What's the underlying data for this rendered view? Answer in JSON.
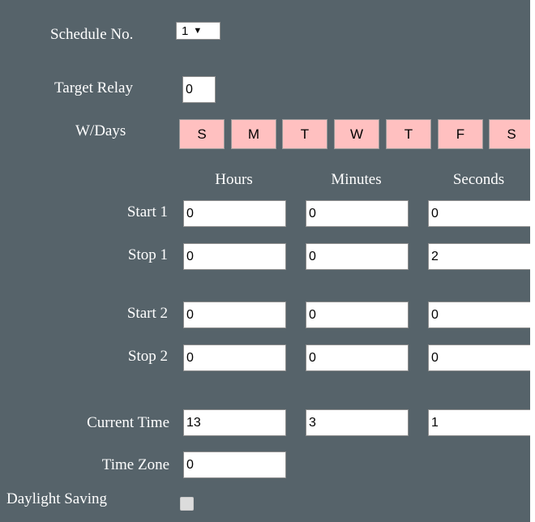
{
  "schedule": {
    "label": "Schedule No.",
    "selected": "1"
  },
  "target_relay": {
    "label": "Target Relay",
    "value": "0"
  },
  "weekdays": {
    "label": "W/Days",
    "days": [
      "S",
      "M",
      "T",
      "W",
      "T",
      "F",
      "S"
    ]
  },
  "columns": {
    "hours": "Hours",
    "minutes": "Minutes",
    "seconds": "Seconds"
  },
  "rows": {
    "start1": {
      "label": "Start 1",
      "hours": "0",
      "minutes": "0",
      "seconds": "0"
    },
    "stop1": {
      "label": "Stop 1",
      "hours": "0",
      "minutes": "0",
      "seconds": "2"
    },
    "start2": {
      "label": "Start 2",
      "hours": "0",
      "minutes": "0",
      "seconds": "0"
    },
    "stop2": {
      "label": "Stop 2",
      "hours": "0",
      "minutes": "0",
      "seconds": "0"
    },
    "current_time": {
      "label": "Current Time",
      "hours": "13",
      "minutes": "3",
      "seconds": "1"
    }
  },
  "time_zone": {
    "label": "Time Zone",
    "value": "0"
  },
  "daylight_saving": {
    "label": "Daylight Saving",
    "checked": false
  },
  "colors": {
    "panel_bg": "#56636a",
    "day_button_bg": "#ffc0c0"
  }
}
